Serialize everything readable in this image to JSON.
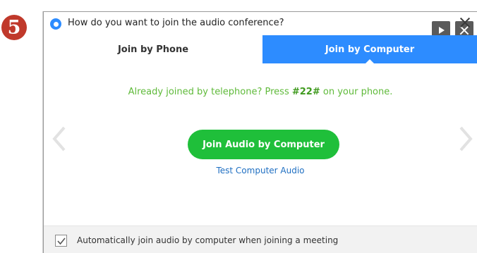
{
  "step": {
    "number": "5",
    "color": "#c0392b"
  },
  "window": {
    "title": "How do you want to join the audio conference?",
    "icons": {
      "app": "zoom-app-icon",
      "play": "play-icon",
      "close": "close-icon"
    }
  },
  "tabs": [
    {
      "label": "Join by Phone",
      "active": false
    },
    {
      "label": "Join by Computer",
      "active": true
    }
  ],
  "content": {
    "already_prefix": "Already joined by telephone? Press ",
    "already_code": "#22#",
    "already_suffix": " on your phone.",
    "join_button": "Join Audio by Computer",
    "test_link": "Test Computer Audio",
    "icons": {
      "prev": "chevron-left-icon",
      "next": "chevron-right-icon"
    }
  },
  "footer": {
    "checkbox_checked": true,
    "label": "Automatically join audio by computer when joining a meeting"
  },
  "colors": {
    "accent": "#2d8cff",
    "join_green": "#1fbf3a",
    "text_green": "#5fba3a",
    "link_blue": "#1f6fc2"
  }
}
